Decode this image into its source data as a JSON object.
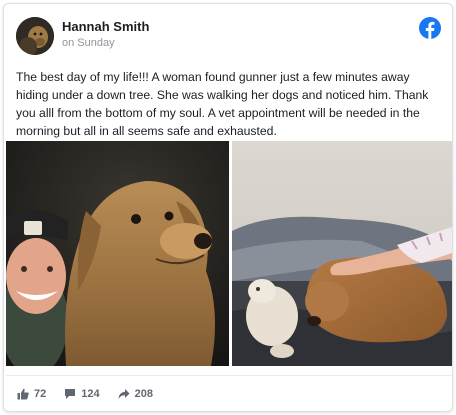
{
  "author": {
    "name": "Hannah Smith",
    "timestamp": "on Sunday",
    "avatar_icon": "profile-photo-dog"
  },
  "brand": {
    "icon": "facebook-logo-icon",
    "color": "#1877f2"
  },
  "post": {
    "text": "The best day of my life!!! A woman found gunner just a few minutes away hiding under a down tree. She was walking her dogs and noticed him. Thank you alll from the bottom of my soul. A vet appointment will be needed in the morning but all in all seems safe and exhausted."
  },
  "photos": [
    {
      "description_icon": "selfie-with-golden-retriever-photo"
    },
    {
      "description_icon": "dog-resting-on-bed-photo"
    }
  ],
  "stats": {
    "likes": "72",
    "comments": "124",
    "shares": "208"
  }
}
